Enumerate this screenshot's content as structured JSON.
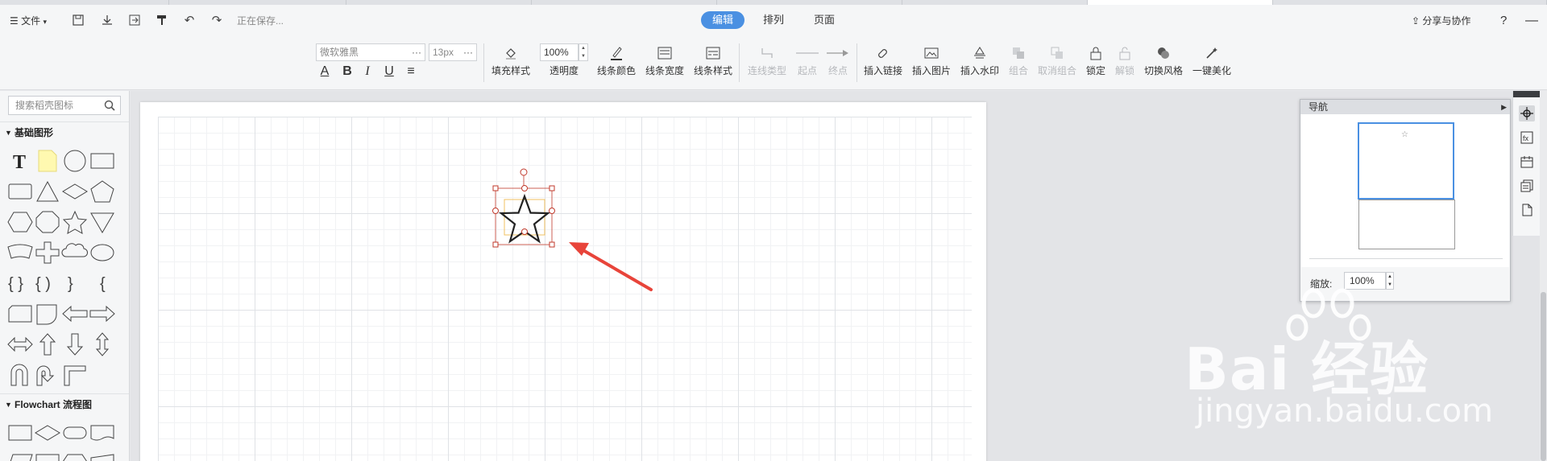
{
  "topbar": {
    "file_menu": "文件",
    "saving_status": "正在保存...",
    "share_label": "分享与协作",
    "help": "?"
  },
  "mode_tabs": [
    {
      "label": "编辑",
      "active": true
    },
    {
      "label": "排列",
      "active": false
    },
    {
      "label": "页面",
      "active": false
    }
  ],
  "toolbar": {
    "font_family": "微软雅黑",
    "font_size": "13px",
    "opacity_value": "100%",
    "tools": [
      {
        "label": "填充样式",
        "icon": "fill-icon",
        "enabled": true
      },
      {
        "label": "透明度",
        "icon": "opacity-icon",
        "enabled": true
      },
      {
        "label": "线条颜色",
        "icon": "line-color-icon",
        "enabled": true
      },
      {
        "label": "线条宽度",
        "icon": "line-width-icon",
        "enabled": true
      },
      {
        "label": "线条样式",
        "icon": "line-style-icon",
        "enabled": true
      },
      {
        "label": "连线类型",
        "icon": "connector-icon",
        "enabled": false
      },
      {
        "label": "起点",
        "icon": "start-point-icon",
        "enabled": false
      },
      {
        "label": "终点",
        "icon": "end-point-icon",
        "enabled": false
      },
      {
        "label": "插入链接",
        "icon": "link-icon",
        "enabled": true
      },
      {
        "label": "插入图片",
        "icon": "image-icon",
        "enabled": true
      },
      {
        "label": "插入水印",
        "icon": "watermark-icon",
        "enabled": true
      },
      {
        "label": "组合",
        "icon": "group-icon",
        "enabled": false
      },
      {
        "label": "取消组合",
        "icon": "ungroup-icon",
        "enabled": false
      },
      {
        "label": "锁定",
        "icon": "lock-icon",
        "enabled": true
      },
      {
        "label": "解锁",
        "icon": "unlock-icon",
        "enabled": false
      },
      {
        "label": "切换风格",
        "icon": "theme-icon",
        "enabled": true
      },
      {
        "label": "一键美化",
        "icon": "magic-wand-icon",
        "enabled": true
      }
    ]
  },
  "left_panel": {
    "search_placeholder": "搜索稻壳图标",
    "section_basic": "基础图形",
    "section_flowchart": "Flowchart 流程图"
  },
  "nav_panel": {
    "title": "导航",
    "zoom_label": "缩放:",
    "zoom_value": "100%"
  },
  "watermark": {
    "brand": "Bai  经验",
    "url": "jingyan.baidu.com"
  },
  "colors": {
    "accent": "#4a90e2",
    "selection": "#c0392b",
    "arrow": "#e8443a"
  }
}
